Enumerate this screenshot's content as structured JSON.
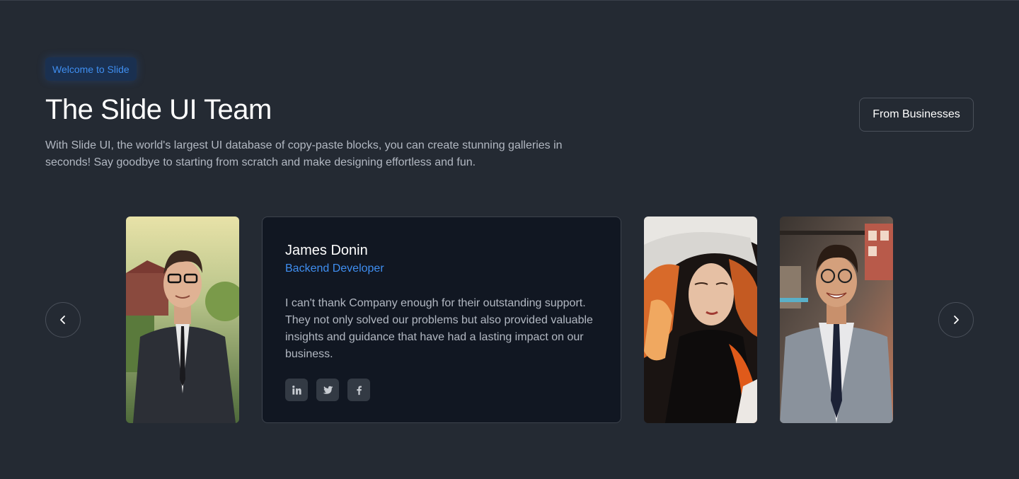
{
  "header": {
    "badge": "Welcome to Slide",
    "title": "The Slide UI Team",
    "subtitle": "With Slide UI, the world's largest UI database of copy-paste blocks, you can create stunning galleries in seconds! Say goodbye to starting from scratch and make designing effortless and fun.",
    "cta_label": "From Businesses"
  },
  "carousel": {
    "prev_icon": "chevron-left-icon",
    "next_icon": "chevron-right-icon",
    "active": {
      "name": "James Donin",
      "role": "Backend Developer",
      "quote": "I can't thank Company enough for their outstanding support. They not only solved our problems but also provided valuable insights and guidance that have had a lasting impact on our business.",
      "socials": [
        "linkedin-icon",
        "twitter-icon",
        "facebook-icon"
      ]
    }
  },
  "colors": {
    "background": "#242a33",
    "card": "#111722",
    "accent": "#3f8ef0",
    "muted_text": "#b2b8c2",
    "border": "#4a505a"
  }
}
